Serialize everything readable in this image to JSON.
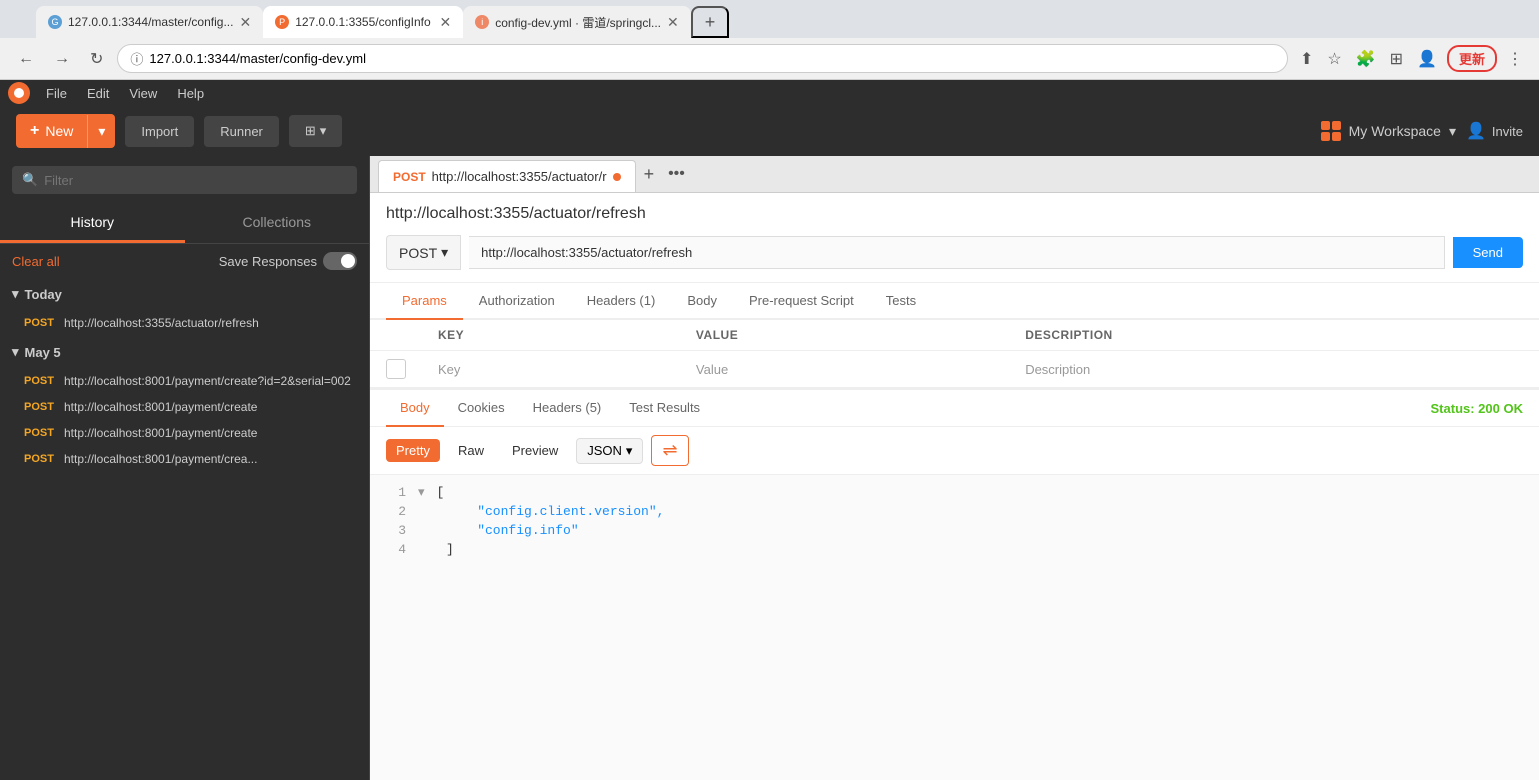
{
  "browser": {
    "tabs": [
      {
        "id": "tab1",
        "favicon_color": "#5c9fd4",
        "title": "127.0.0.1:3344/master/config...",
        "active": false
      },
      {
        "id": "tab2",
        "favicon_color": "#f26b30",
        "title": "127.0.0.1:3355/configInfo",
        "active": true
      },
      {
        "id": "tab3",
        "favicon_color": "#666",
        "title": "config-dev.yml · 雷道/springcl...",
        "active": false
      }
    ],
    "address": "127.0.0.1:3344/master/config-dev.yml",
    "new_tab_label": "+",
    "update_btn_label": "更新",
    "nav": {
      "back": "←",
      "forward": "→",
      "refresh": "↻"
    }
  },
  "postman": {
    "logo": "P",
    "menu": [
      "File",
      "Edit",
      "View",
      "Help"
    ],
    "header": {
      "new_label": "New",
      "import_label": "Import",
      "runner_label": "Runner",
      "workspace_label": "My Workspace",
      "invite_label": "Invite"
    },
    "sidebar": {
      "search_placeholder": "Filter",
      "tab_history": "History",
      "tab_collections": "Collections",
      "clear_all": "Clear all",
      "save_responses": "Save Responses",
      "sections": [
        {
          "title": "Today",
          "items": [
            {
              "method": "POST",
              "url": "http://localhost:3355/actuator/refresh"
            }
          ]
        },
        {
          "title": "May 5",
          "items": [
            {
              "method": "POST",
              "url": "http://localhost:8001/payment/create?id=2&serial=002"
            },
            {
              "method": "POST",
              "url": "http://localhost:8001/payment/create"
            },
            {
              "method": "POST",
              "url": "http://localhost:8001/payment/create"
            },
            {
              "method": "POST",
              "url": "http://localhost:8001/payment/crea..."
            }
          ]
        }
      ]
    },
    "request": {
      "active_tab_method": "POST",
      "active_tab_url": "http://localhost:3355/actuator/r",
      "url_title": "http://localhost:3355/actuator/refresh",
      "method": "POST",
      "url_value": "http://localhost:3355/actuator/refresh",
      "send_label": "Send",
      "sub_tabs": [
        "Params",
        "Authorization",
        "Headers (1)",
        "Body",
        "Pre-request Script",
        "Tests"
      ],
      "active_sub_tab": "Params",
      "params_table": {
        "columns": [
          "KEY",
          "VALUE",
          "DESCRIPTION"
        ],
        "rows": [
          {
            "key": "Key",
            "value": "Value",
            "description": "Description"
          }
        ]
      }
    },
    "response": {
      "tabs": [
        "Body",
        "Cookies",
        "Headers (5)",
        "Test Results"
      ],
      "active_tab": "Body",
      "status": "Status: 200 OK",
      "format_options": [
        "Pretty",
        "Raw",
        "Preview"
      ],
      "active_format": "Pretty",
      "content_type": "JSON",
      "body_lines": [
        {
          "num": "1",
          "content": "[",
          "type": "bracket",
          "expand": "▾"
        },
        {
          "num": "2",
          "content": "\"config.client.version\",",
          "type": "string"
        },
        {
          "num": "3",
          "content": "\"config.info\"",
          "type": "string"
        },
        {
          "num": "4",
          "content": "]",
          "type": "bracket"
        }
      ]
    }
  }
}
